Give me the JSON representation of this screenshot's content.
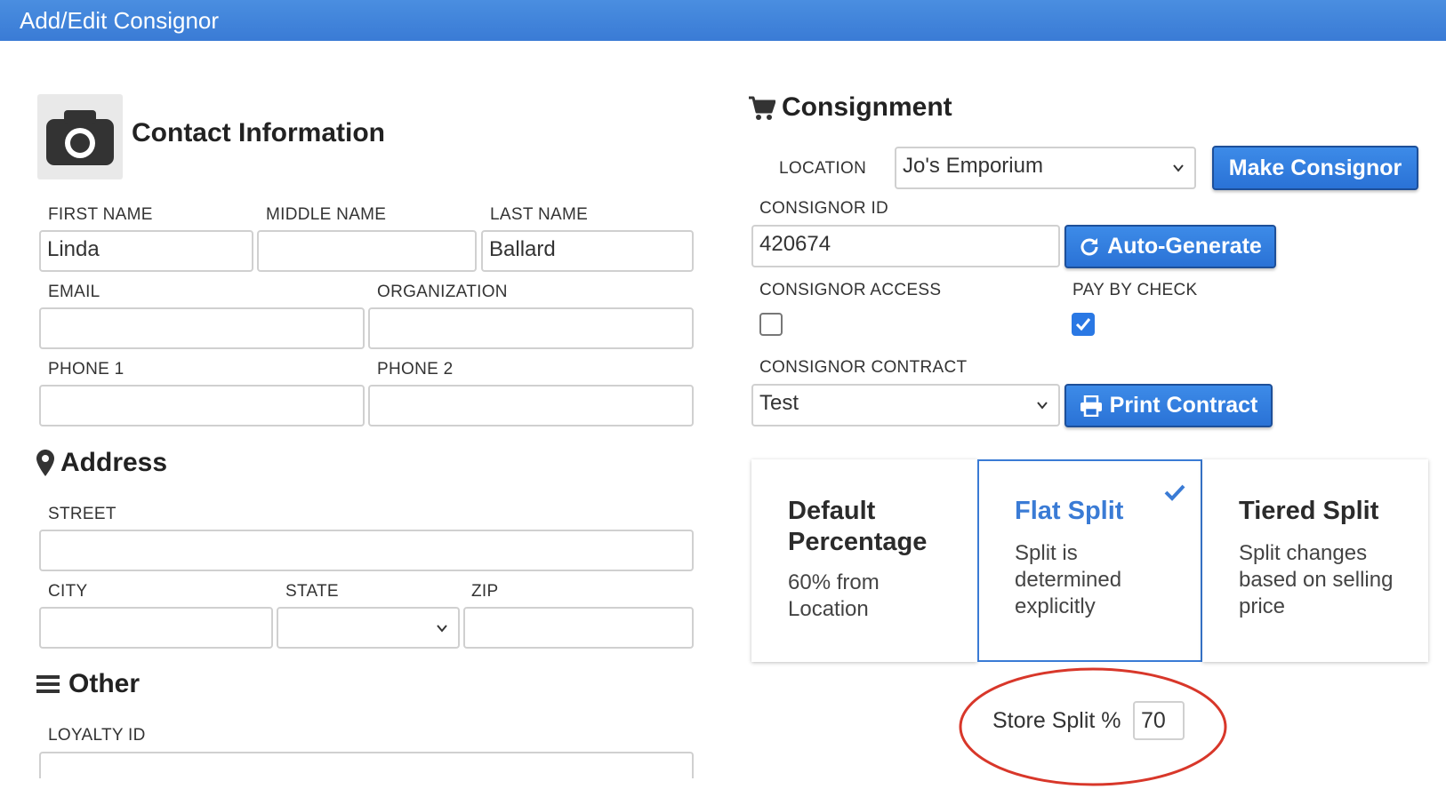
{
  "window": {
    "title": "Add/Edit Consignor"
  },
  "contact": {
    "heading": "Contact Information",
    "first_name": {
      "label": "FIRST NAME",
      "value": "Linda"
    },
    "middle_name": {
      "label": "MIDDLE NAME",
      "value": ""
    },
    "last_name": {
      "label": "LAST NAME",
      "value": "Ballard"
    },
    "email": {
      "label": "EMAIL",
      "value": ""
    },
    "organization": {
      "label": "ORGANIZATION",
      "value": ""
    },
    "phone1": {
      "label": "PHONE 1",
      "value": ""
    },
    "phone2": {
      "label": "PHONE 2",
      "value": ""
    }
  },
  "address": {
    "heading": "Address",
    "street": {
      "label": "STREET",
      "value": ""
    },
    "city": {
      "label": "CITY",
      "value": ""
    },
    "state": {
      "label": "STATE",
      "value": ""
    },
    "zip": {
      "label": "ZIP",
      "value": ""
    }
  },
  "other": {
    "heading": "Other",
    "loyalty_id": {
      "label": "LOYALTY ID",
      "value": ""
    }
  },
  "consignment": {
    "heading": "Consignment",
    "location": {
      "label": "LOCATION",
      "value": "Jo's Emporium"
    },
    "make_consignor_label": "Make Consignor",
    "consignor_id": {
      "label": "CONSIGNOR ID",
      "value": "420674"
    },
    "auto_generate_label": "Auto-Generate",
    "consignor_access": {
      "label": "CONSIGNOR ACCESS",
      "checked": false
    },
    "pay_by_check": {
      "label": "PAY BY CHECK",
      "checked": true
    },
    "contract": {
      "label": "CONSIGNOR CONTRACT",
      "value": "Test"
    },
    "print_contract_label": "Print Contract"
  },
  "split_options": [
    {
      "title": "Default Percentage",
      "description": "60% from Location",
      "selected": false
    },
    {
      "title": "Flat Split",
      "description": "Split is determined explicitly",
      "selected": true
    },
    {
      "title": "Tiered Split",
      "description": "Split changes based on selling price",
      "selected": false
    }
  ],
  "store_split": {
    "label": "Store Split %",
    "value": "70"
  },
  "colors": {
    "accent": "#3a7bd5",
    "checkbox_checked": "#2a78e4",
    "annotation": "#d8372a"
  },
  "icons": {
    "contact": "camera-icon",
    "address": "map-marker-icon",
    "other": "bars-icon",
    "consignment": "shopping-cart-icon",
    "auto_generate": "refresh-icon",
    "print_contract": "print-icon"
  }
}
